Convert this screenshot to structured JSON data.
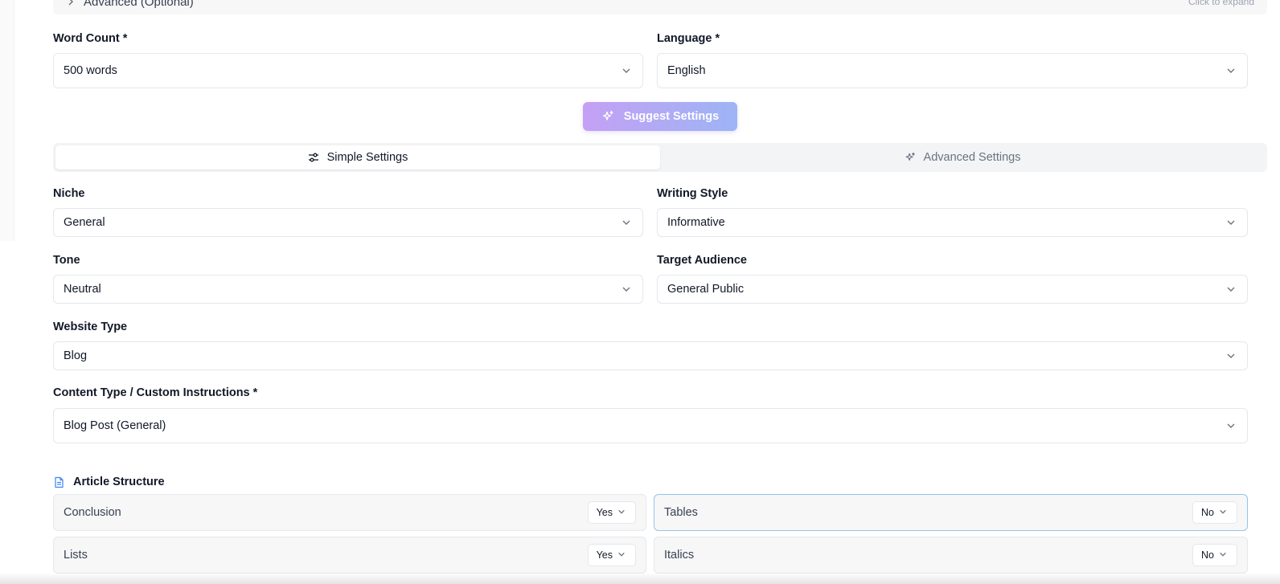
{
  "accordion": {
    "title": "Advanced (Optional)",
    "hint": "Click to expand"
  },
  "word_count": {
    "label": "Word Count *",
    "value": "500 words"
  },
  "language": {
    "label": "Language *",
    "value": "English"
  },
  "suggest": {
    "label": "Suggest Settings"
  },
  "tabs": [
    {
      "label": "Simple Settings",
      "icon": "sliders-icon"
    },
    {
      "label": "Advanced Settings",
      "icon": "sparkles-icon"
    }
  ],
  "niche": {
    "label": "Niche",
    "value": "General"
  },
  "writing_style": {
    "label": "Writing Style",
    "value": "Informative"
  },
  "tone": {
    "label": "Tone",
    "value": "Neutral"
  },
  "target_audience": {
    "label": "Target Audience",
    "value": "General Public"
  },
  "website_type": {
    "label": "Website Type",
    "value": "Blog"
  },
  "content_type": {
    "label": "Content Type / Custom Instructions *",
    "value": "Blog Post (General)"
  },
  "article_structure": {
    "title": "Article Structure",
    "items": [
      {
        "label": "Conclusion",
        "value": "Yes"
      },
      {
        "label": "Tables",
        "value": "No"
      },
      {
        "label": "Lists",
        "value": "Yes"
      },
      {
        "label": "Italics",
        "value": "No"
      }
    ]
  },
  "colors": {
    "accent_gradient_start": "#c4a0f5",
    "accent_gradient_end": "#9db4f5",
    "doc_icon": "#3b82f6",
    "highlight_border": "#93c5e8"
  }
}
